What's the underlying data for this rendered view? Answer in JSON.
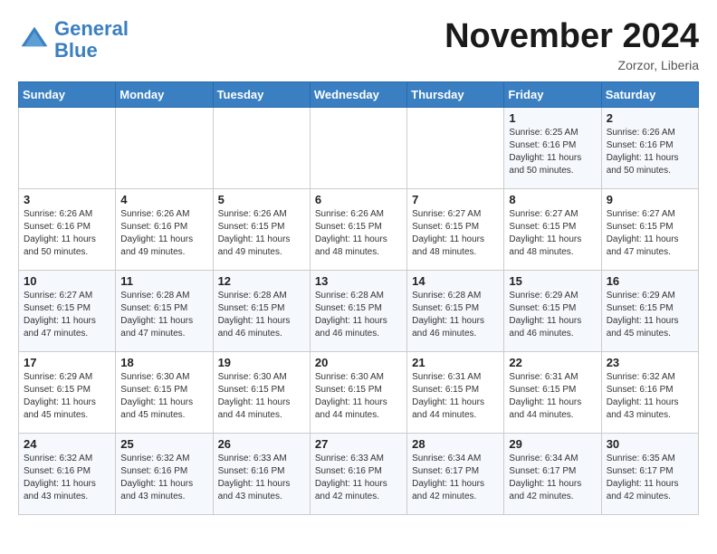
{
  "header": {
    "logo_general": "General",
    "logo_blue": "Blue",
    "month_title": "November 2024",
    "location": "Zorzor, Liberia"
  },
  "days_of_week": [
    "Sunday",
    "Monday",
    "Tuesday",
    "Wednesday",
    "Thursday",
    "Friday",
    "Saturday"
  ],
  "weeks": [
    [
      {
        "day": "",
        "info": ""
      },
      {
        "day": "",
        "info": ""
      },
      {
        "day": "",
        "info": ""
      },
      {
        "day": "",
        "info": ""
      },
      {
        "day": "",
        "info": ""
      },
      {
        "day": "1",
        "info": "Sunrise: 6:25 AM\nSunset: 6:16 PM\nDaylight: 11 hours\nand 50 minutes."
      },
      {
        "day": "2",
        "info": "Sunrise: 6:26 AM\nSunset: 6:16 PM\nDaylight: 11 hours\nand 50 minutes."
      }
    ],
    [
      {
        "day": "3",
        "info": "Sunrise: 6:26 AM\nSunset: 6:16 PM\nDaylight: 11 hours\nand 50 minutes."
      },
      {
        "day": "4",
        "info": "Sunrise: 6:26 AM\nSunset: 6:16 PM\nDaylight: 11 hours\nand 49 minutes."
      },
      {
        "day": "5",
        "info": "Sunrise: 6:26 AM\nSunset: 6:15 PM\nDaylight: 11 hours\nand 49 minutes."
      },
      {
        "day": "6",
        "info": "Sunrise: 6:26 AM\nSunset: 6:15 PM\nDaylight: 11 hours\nand 48 minutes."
      },
      {
        "day": "7",
        "info": "Sunrise: 6:27 AM\nSunset: 6:15 PM\nDaylight: 11 hours\nand 48 minutes."
      },
      {
        "day": "8",
        "info": "Sunrise: 6:27 AM\nSunset: 6:15 PM\nDaylight: 11 hours\nand 48 minutes."
      },
      {
        "day": "9",
        "info": "Sunrise: 6:27 AM\nSunset: 6:15 PM\nDaylight: 11 hours\nand 47 minutes."
      }
    ],
    [
      {
        "day": "10",
        "info": "Sunrise: 6:27 AM\nSunset: 6:15 PM\nDaylight: 11 hours\nand 47 minutes."
      },
      {
        "day": "11",
        "info": "Sunrise: 6:28 AM\nSunset: 6:15 PM\nDaylight: 11 hours\nand 47 minutes."
      },
      {
        "day": "12",
        "info": "Sunrise: 6:28 AM\nSunset: 6:15 PM\nDaylight: 11 hours\nand 46 minutes."
      },
      {
        "day": "13",
        "info": "Sunrise: 6:28 AM\nSunset: 6:15 PM\nDaylight: 11 hours\nand 46 minutes."
      },
      {
        "day": "14",
        "info": "Sunrise: 6:28 AM\nSunset: 6:15 PM\nDaylight: 11 hours\nand 46 minutes."
      },
      {
        "day": "15",
        "info": "Sunrise: 6:29 AM\nSunset: 6:15 PM\nDaylight: 11 hours\nand 46 minutes."
      },
      {
        "day": "16",
        "info": "Sunrise: 6:29 AM\nSunset: 6:15 PM\nDaylight: 11 hours\nand 45 minutes."
      }
    ],
    [
      {
        "day": "17",
        "info": "Sunrise: 6:29 AM\nSunset: 6:15 PM\nDaylight: 11 hours\nand 45 minutes."
      },
      {
        "day": "18",
        "info": "Sunrise: 6:30 AM\nSunset: 6:15 PM\nDaylight: 11 hours\nand 45 minutes."
      },
      {
        "day": "19",
        "info": "Sunrise: 6:30 AM\nSunset: 6:15 PM\nDaylight: 11 hours\nand 44 minutes."
      },
      {
        "day": "20",
        "info": "Sunrise: 6:30 AM\nSunset: 6:15 PM\nDaylight: 11 hours\nand 44 minutes."
      },
      {
        "day": "21",
        "info": "Sunrise: 6:31 AM\nSunset: 6:15 PM\nDaylight: 11 hours\nand 44 minutes."
      },
      {
        "day": "22",
        "info": "Sunrise: 6:31 AM\nSunset: 6:15 PM\nDaylight: 11 hours\nand 44 minutes."
      },
      {
        "day": "23",
        "info": "Sunrise: 6:32 AM\nSunset: 6:16 PM\nDaylight: 11 hours\nand 43 minutes."
      }
    ],
    [
      {
        "day": "24",
        "info": "Sunrise: 6:32 AM\nSunset: 6:16 PM\nDaylight: 11 hours\nand 43 minutes."
      },
      {
        "day": "25",
        "info": "Sunrise: 6:32 AM\nSunset: 6:16 PM\nDaylight: 11 hours\nand 43 minutes."
      },
      {
        "day": "26",
        "info": "Sunrise: 6:33 AM\nSunset: 6:16 PM\nDaylight: 11 hours\nand 43 minutes."
      },
      {
        "day": "27",
        "info": "Sunrise: 6:33 AM\nSunset: 6:16 PM\nDaylight: 11 hours\nand 42 minutes."
      },
      {
        "day": "28",
        "info": "Sunrise: 6:34 AM\nSunset: 6:17 PM\nDaylight: 11 hours\nand 42 minutes."
      },
      {
        "day": "29",
        "info": "Sunrise: 6:34 AM\nSunset: 6:17 PM\nDaylight: 11 hours\nand 42 minutes."
      },
      {
        "day": "30",
        "info": "Sunrise: 6:35 AM\nSunset: 6:17 PM\nDaylight: 11 hours\nand 42 minutes."
      }
    ]
  ]
}
